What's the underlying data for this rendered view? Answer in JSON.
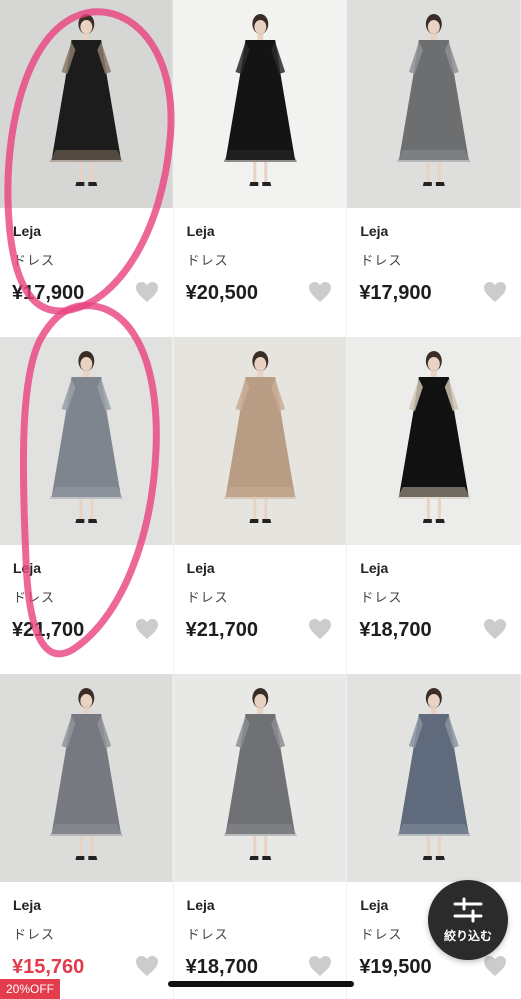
{
  "products": [
    {
      "brand": "Leja",
      "category": "ドレス",
      "price": "¥17,900",
      "badge": "",
      "sale": false,
      "photo_bg": "#d6d7d4",
      "dress": "#1c1c1c",
      "sleeve": "#8a7a68"
    },
    {
      "brand": "Leja",
      "category": "ドレス",
      "price": "¥20,500",
      "badge": "",
      "sale": false,
      "photo_bg": "#f2f2f1",
      "dress": "#141414",
      "sleeve": "#2a2a2a"
    },
    {
      "brand": "Leja",
      "category": "ドレス",
      "price": "¥17,900",
      "badge": "",
      "sale": false,
      "photo_bg": "#dedfdc",
      "dress": "#6c6e70",
      "sleeve": "#8e9094"
    },
    {
      "brand": "Leja",
      "category": "ドレス",
      "price": "¥21,700",
      "badge": "",
      "sale": false,
      "photo_bg": "#e1e2e0",
      "dress": "#7f858e",
      "sleeve": "#9aa0a8"
    },
    {
      "brand": "Leja",
      "category": "ドレス",
      "price": "¥21,700",
      "badge": "",
      "sale": false,
      "photo_bg": "#e6e4df",
      "dress": "#b89c84",
      "sleeve": "#c9ad95"
    },
    {
      "brand": "Leja",
      "category": "ドレス",
      "price": "¥18,700",
      "badge": "",
      "sale": false,
      "photo_bg": "#ececea",
      "dress": "#111111",
      "sleeve": "#cfc3b1"
    },
    {
      "brand": "Leja",
      "category": "ドレス",
      "price": "¥15,760",
      "badge": "20%OFF",
      "sale": true,
      "photo_bg": "#dcdcda",
      "dress": "#767a80",
      "sleeve": "#90949a"
    },
    {
      "brand": "Leja",
      "category": "ドレス",
      "price": "¥18,700",
      "badge": "",
      "sale": false,
      "photo_bg": "#e8e8e6",
      "dress": "#6f7174",
      "sleeve": "#8b8d90"
    },
    {
      "brand": "Leja",
      "category": "ドレス",
      "price": "¥19,500",
      "badge": "",
      "sale": false,
      "photo_bg": "#e2e3e1",
      "dress": "#5f6b7c",
      "sleeve": "#8a93a0"
    }
  ],
  "filter_button": {
    "label": "絞り込む",
    "icon": "sliders-icon"
  },
  "colors": {
    "sale_red": "#e23c4d",
    "heart_grey": "#cccccc",
    "annotation_pink": "#e8427f"
  }
}
